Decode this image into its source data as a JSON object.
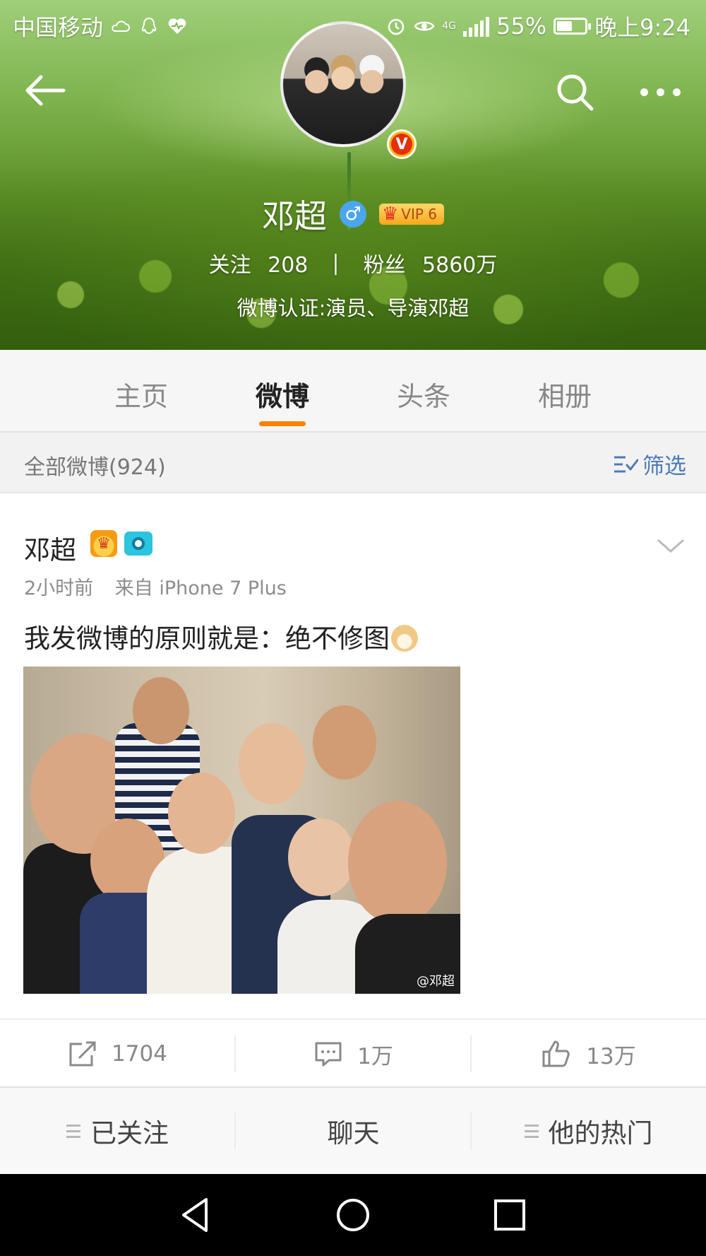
{
  "status_bar": {
    "carrier": "中国移动",
    "network": "4G",
    "battery": "55%",
    "battery_level": 0.55,
    "time": "晚上9:24"
  },
  "profile": {
    "name": "邓超",
    "gender": "♂",
    "vip_label": "VIP 6",
    "verified_badge": "V",
    "following_label": "关注",
    "following_count": "208",
    "separator": "|",
    "fans_label": "粉丝",
    "fans_count": "5860万",
    "verification": "微博认证:演员、导演邓超"
  },
  "tabs": [
    {
      "label": "主页",
      "active": false
    },
    {
      "label": "微博",
      "active": true
    },
    {
      "label": "头条",
      "active": false
    },
    {
      "label": "相册",
      "active": false
    }
  ],
  "filter": {
    "title": "全部微博(924)",
    "button_label": "筛选"
  },
  "post": {
    "author": "邓超",
    "time": "2小时前",
    "source": "来自 iPhone 7 Plus",
    "text": "我发微博的原则就是：绝不修图",
    "photo_watermark": "@邓超"
  },
  "actions": {
    "repost_count": "1704",
    "comment_count": "1万",
    "like_count": "13万"
  },
  "toolbar": {
    "followed_label": "已关注",
    "chat_label": "聊天",
    "hot_label": "他的热门"
  },
  "icons": {
    "back": "arrow-left-icon",
    "search": "search-icon",
    "more": "more-dots-icon",
    "repost": "share-icon",
    "comment": "comment-icon",
    "like": "thumbs-up-icon"
  },
  "colors": {
    "accent": "#ff8200",
    "link": "#4d79b8",
    "gender_badge": "#4aa6ee"
  }
}
